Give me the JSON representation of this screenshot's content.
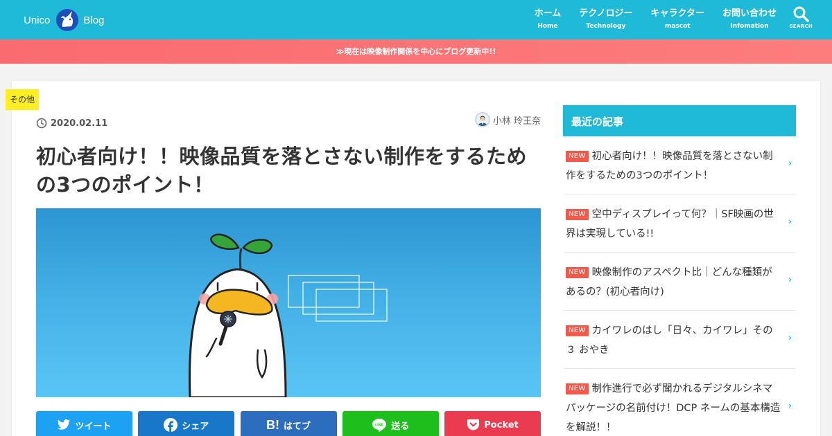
{
  "header": {
    "logo_left": "Unico",
    "logo_right": "Blog",
    "nav": [
      {
        "label": "ホーム",
        "sub": "Home"
      },
      {
        "label": "テクノロジー",
        "sub": "Technology"
      },
      {
        "label": "キャラクター",
        "sub": "mascot"
      },
      {
        "label": "お問い合わせ",
        "sub": "Infomation"
      }
    ],
    "search_label": "SEARCH"
  },
  "notice": "≫現在は映像制作関係を中心にブログ更新中!!",
  "article": {
    "category": "その他",
    "date": "2020.02.11",
    "author": "小林 玲王奈",
    "title": "初心者向け！！映像品質を落とさない制作をするための3つのポイント！"
  },
  "share": [
    {
      "label": "ツイート",
      "icon": "twitter-icon",
      "color": "#1da1f2"
    },
    {
      "label": "シェア",
      "icon": "facebook-icon",
      "color": "#1877c8"
    },
    {
      "label": "はてブ",
      "icon": "hatena-icon",
      "glyph": "B!",
      "color": "#2c6ebd"
    },
    {
      "label": "送る",
      "icon": "line-icon",
      "color": "#1dbf1d"
    },
    {
      "label": "Pocket",
      "icon": "pocket-icon",
      "color": "#ea3b51"
    }
  ],
  "sidebar": {
    "heading": "最近の記事",
    "badge": "NEW",
    "items": [
      {
        "title": "初心者向け！！映像品質を落とさない制作をするための3つのポイント！"
      },
      {
        "title": "空中ディスプレイって何？｜SF映画の世界は実現している!!"
      },
      {
        "title": "映像制作のアスペクト比｜どんな種類があるの？(初心者向け)"
      },
      {
        "title": "カイワレのはし「日々、カイワレ」その３ おやき"
      },
      {
        "title": "制作進行で必ず聞かれるデジタルシネマパッケージの名前付け！DCP ネームの基本構造を解説！！"
      }
    ]
  },
  "colors": {
    "brand": "#1ebad8",
    "notice": "#fb7476",
    "new_badge": "#f15a4a",
    "category_badge": "#ffee22"
  }
}
